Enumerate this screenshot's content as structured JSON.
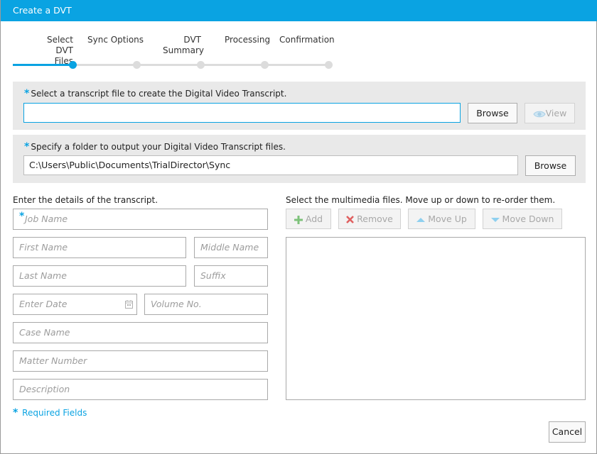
{
  "window": {
    "title": "Create a DVT"
  },
  "stepper": {
    "steps": [
      {
        "label_line1": "Select DVT",
        "label_line2": "Files"
      },
      {
        "label_line1": "Sync Options",
        "label_line2": ""
      },
      {
        "label_line1": "DVT",
        "label_line2": "Summary"
      },
      {
        "label_line1": "Processing",
        "label_line2": ""
      },
      {
        "label_line1": "Confirmation",
        "label_line2": ""
      }
    ],
    "active_step": 1
  },
  "transcript_panel": {
    "required_mark": "*",
    "label": "Select a transcript file to create the Digital Video Transcript.",
    "value": "",
    "browse_label": "Browse",
    "view_label": "View"
  },
  "output_panel": {
    "required_mark": "*",
    "label": "Specify a folder to output your Digital Video Transcript files.",
    "value": "C:\\Users\\Public\\Documents\\TrialDirector\\Sync",
    "browse_label": "Browse"
  },
  "details": {
    "heading": "Enter the details of the transcript.",
    "job_name": {
      "required_mark": "*",
      "placeholder": "Job Name"
    },
    "first_name": "First Name",
    "middle_name": "Middle Name",
    "last_name": "Last Name",
    "suffix": "Suffix",
    "enter_date": "Enter Date",
    "volume_no": "Volume No.",
    "case_name": "Case Name",
    "matter_number": "Matter Number",
    "description": "Description"
  },
  "multimedia": {
    "heading": "Select the multimedia files. Move up or down to re-order them.",
    "add_label": "Add",
    "remove_label": "Remove",
    "move_up_label": "Move Up",
    "move_down_label": "Move Down"
  },
  "footer": {
    "required_mark": "*",
    "required_note": "Required Fields",
    "cancel_label": "Cancel"
  },
  "colors": {
    "accent": "#0aa3e2",
    "add_icon": "#7dc27a",
    "remove_icon": "#e06060",
    "arrow_icon": "#8fd0ef"
  }
}
